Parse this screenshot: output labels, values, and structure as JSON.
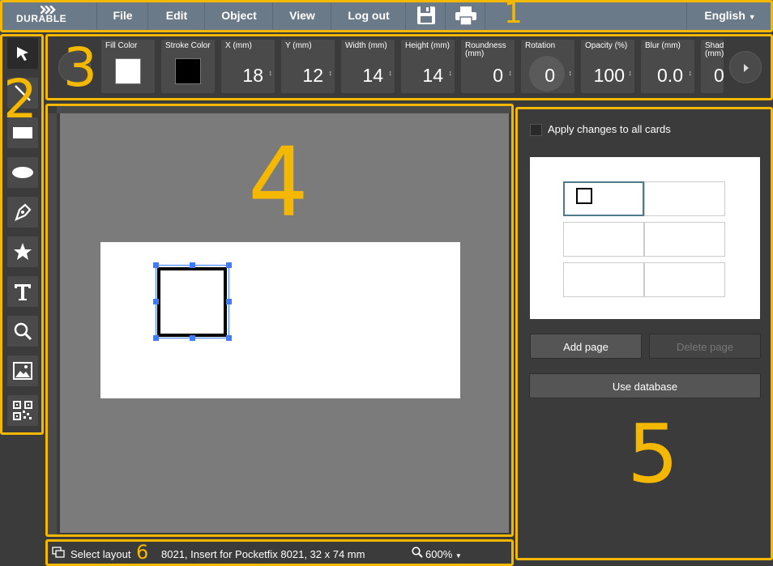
{
  "app": {
    "logo_text": "DURABLE",
    "menu": [
      "File",
      "Edit",
      "Object",
      "View",
      "Log out"
    ],
    "save_icon": "floppy-disk-icon",
    "print_icon": "printer-icon",
    "language": "English",
    "accent_color": "#f5b800",
    "menubar_color": "#6b7a88"
  },
  "annotations": [
    "1",
    "2",
    "3",
    "4",
    "5",
    "6"
  ],
  "tools": [
    {
      "name": "select-tool",
      "icon": "arrow-cursor-icon"
    },
    {
      "name": "line-tool",
      "icon": "line-icon"
    },
    {
      "name": "rectangle-tool",
      "icon": "rectangle-icon"
    },
    {
      "name": "ellipse-tool",
      "icon": "ellipse-icon"
    },
    {
      "name": "pen-tool",
      "icon": "pen-nib-icon"
    },
    {
      "name": "star-tool",
      "icon": "star-icon"
    },
    {
      "name": "text-tool",
      "icon": "text-icon"
    },
    {
      "name": "zoom-tool",
      "icon": "magnifier-icon"
    },
    {
      "name": "image-tool",
      "icon": "image-icon"
    },
    {
      "name": "qrcode-tool",
      "icon": "qrcode-icon"
    }
  ],
  "props": {
    "fill_label": "Fill Color",
    "fill_color": "#ffffff",
    "stroke_label": "Stroke Color",
    "stroke_color": "#000000",
    "x_label": "X (mm)",
    "x_value": "18",
    "y_label": "Y (mm)",
    "y_value": "12",
    "width_label": "Width (mm)",
    "width_value": "14",
    "height_label": "Height (mm)",
    "height_value": "14",
    "roundness_label": "Roundness (mm)",
    "roundness_value": "0",
    "rotation_label": "Rotation",
    "rotation_value": "0",
    "opacity_label": "Opacity (%)",
    "opacity_value": "100",
    "blur_label": "Blur (mm)",
    "blur_value": "0.0",
    "shadow_label": "Shad (mm)",
    "shadow_value": "0"
  },
  "panel": {
    "apply_all_label": "Apply changes to all cards",
    "add_page": "Add page",
    "delete_page": "Delete page",
    "use_database": "Use database"
  },
  "status": {
    "select_layout": "Select layout",
    "layout_info": "8021, Insert for Pocketfix 8021, 32 x 74 mm",
    "zoom": "600%"
  }
}
